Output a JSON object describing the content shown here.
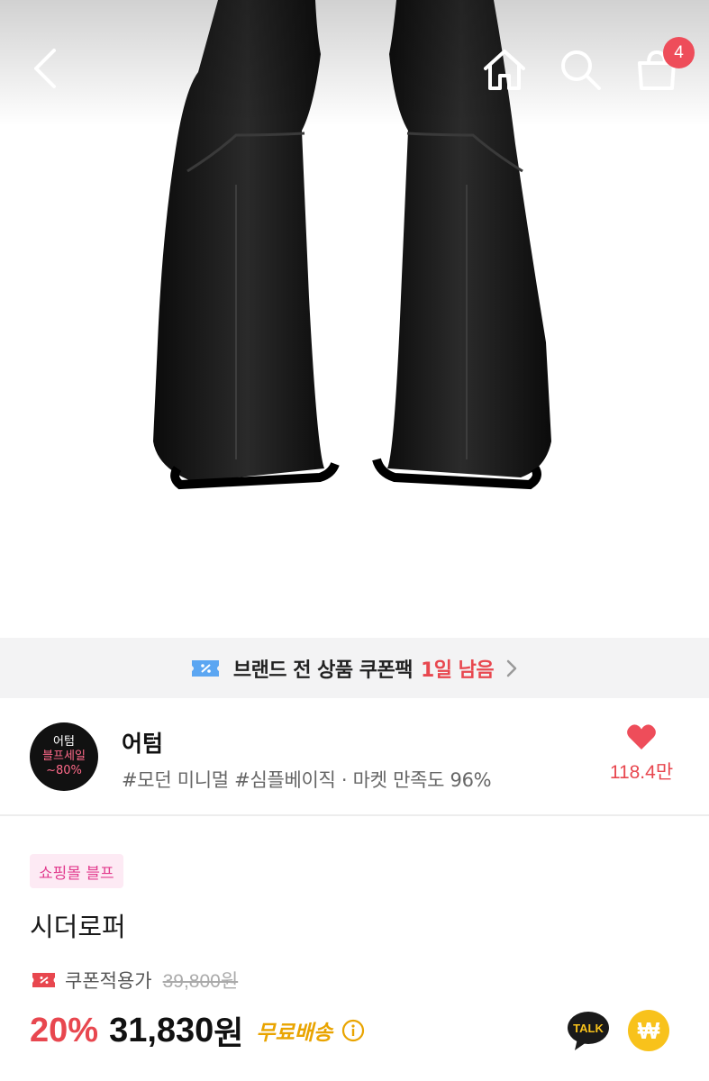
{
  "header": {
    "cart_count": "4",
    "icons": [
      "back-icon",
      "home-icon",
      "search-icon",
      "shopping-bag-icon"
    ]
  },
  "coupon_banner": {
    "label": "브랜드 전 상품 쿠폰팩",
    "remaining": "1일 남음"
  },
  "store": {
    "logo_line1": "어텀",
    "logo_line2": "블프세일",
    "logo_line3": "~80%",
    "name": "어텀",
    "tags": "#모던 미니멀 #심플베이직 · 마켓 만족도 96%",
    "like_count": "118.4만"
  },
  "product": {
    "promo_tag": "쇼핑몰 블프",
    "name": "시더로퍼",
    "coupon_price_label": "쿠폰적용가",
    "original_price": "39,800원",
    "discount_rate": "20%",
    "final_price": "31,830",
    "currency": "원",
    "shipping": "무료배송",
    "talk_label": "TALK",
    "pay_symbol": "₩"
  },
  "colors": {
    "accent_red": "#e8474f",
    "promo_pink": "#e23c8e",
    "shipping_gold": "#e9a400",
    "pay_yellow": "#f8c21b"
  }
}
